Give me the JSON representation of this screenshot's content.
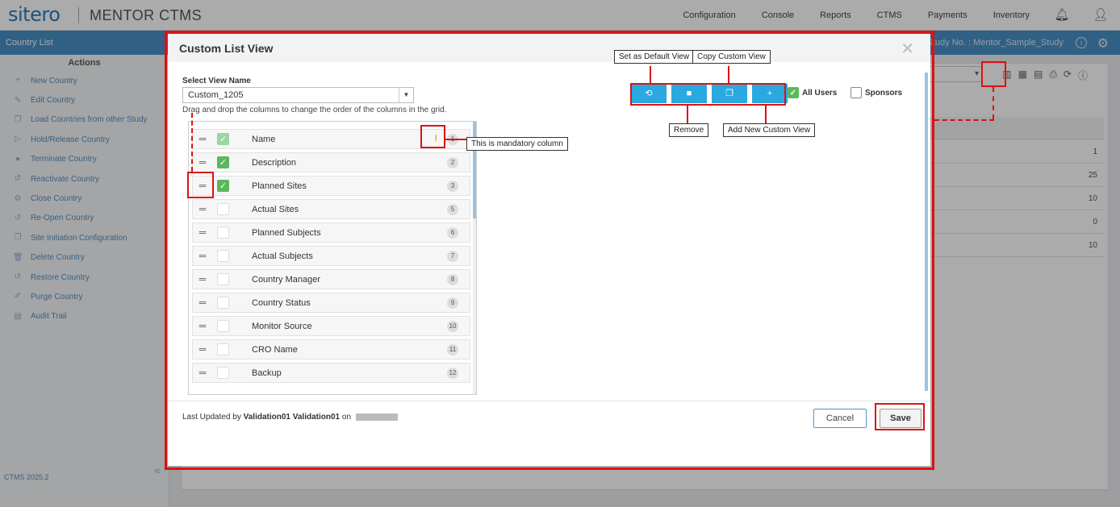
{
  "app": {
    "logo": "sitero",
    "product": "MENTOR CTMS",
    "nav": [
      "Configuration",
      "Console",
      "Reports",
      "CTMS",
      "Payments",
      "Inventory"
    ],
    "version": "CTMS 2025.2"
  },
  "subheader": {
    "page": "Country List",
    "study": "Study No. : Mentor_Sample_Study"
  },
  "sidebar": {
    "title": "Actions",
    "items": [
      {
        "label": "New Country",
        "icon": "plus-icon"
      },
      {
        "label": "Edit Country",
        "icon": "pencil-icon"
      },
      {
        "label": "Load Countries from other Study",
        "icon": "copy-icon"
      },
      {
        "label": "Hold/Release Country",
        "icon": "play-icon"
      },
      {
        "label": "Terminate Country",
        "icon": "info-icon"
      },
      {
        "label": "Reactivate Country",
        "icon": "restore-icon"
      },
      {
        "label": "Close Country",
        "icon": "gear-icon"
      },
      {
        "label": "Re-Open Country",
        "icon": "restore-icon"
      },
      {
        "label": "Site Initiation Configuration",
        "icon": "copy-icon"
      },
      {
        "label": "Delete Country",
        "icon": "trash-icon"
      },
      {
        "label": "Restore Country",
        "icon": "restore-icon"
      },
      {
        "label": "Purge Country",
        "icon": "eraser-icon"
      },
      {
        "label": "Audit Trail",
        "icon": "document-icon"
      }
    ]
  },
  "background_grid": {
    "values": [
      "1",
      "25",
      "10",
      "0",
      "10"
    ]
  },
  "modal": {
    "title": "Custom List View",
    "select_label": "Select View Name",
    "selected_view": "Custom_1205",
    "hint": "Drag and drop the columns to change the order of the columns in the grid.",
    "columns": [
      {
        "name": "Name",
        "num": "1",
        "checked": true,
        "mandatory": true
      },
      {
        "name": "Description",
        "num": "2",
        "checked": true,
        "mandatory": false
      },
      {
        "name": "Planned Sites",
        "num": "3",
        "checked": true,
        "mandatory": false
      },
      {
        "name": "Actual Sites",
        "num": "5",
        "checked": false,
        "mandatory": false
      },
      {
        "name": "Planned Subjects",
        "num": "6",
        "checked": false,
        "mandatory": false
      },
      {
        "name": "Actual Subjects",
        "num": "7",
        "checked": false,
        "mandatory": false
      },
      {
        "name": "Country Manager",
        "num": "8",
        "checked": false,
        "mandatory": false
      },
      {
        "name": "Country Status",
        "num": "9",
        "checked": false,
        "mandatory": false
      },
      {
        "name": "Monitor Source",
        "num": "10",
        "checked": false,
        "mandatory": false
      },
      {
        "name": "CRO Name",
        "num": "11",
        "checked": false,
        "mandatory": false
      },
      {
        "name": "Backup",
        "num": "12",
        "checked": false,
        "mandatory": false
      }
    ],
    "all_users_label": "All Users",
    "sponsors_label": "Sponsors",
    "all_users_checked": true,
    "sponsors_checked": false,
    "footer": {
      "prefix": "Last Updated by",
      "user": "Validation01 Validation01",
      "on": "on"
    },
    "cancel_label": "Cancel",
    "save_label": "Save"
  },
  "annotations": {
    "set_default": "Set as Default View",
    "copy_view": "Copy Custom View",
    "remove": "Remove",
    "add_new": "Add New Custom View",
    "mandatory": "This is mandatory column"
  },
  "colors": {
    "accent": "#29a9e0",
    "header_blue": "#4a90c7",
    "annotation_red": "#dd1111",
    "check_green": "#5cb85c"
  }
}
